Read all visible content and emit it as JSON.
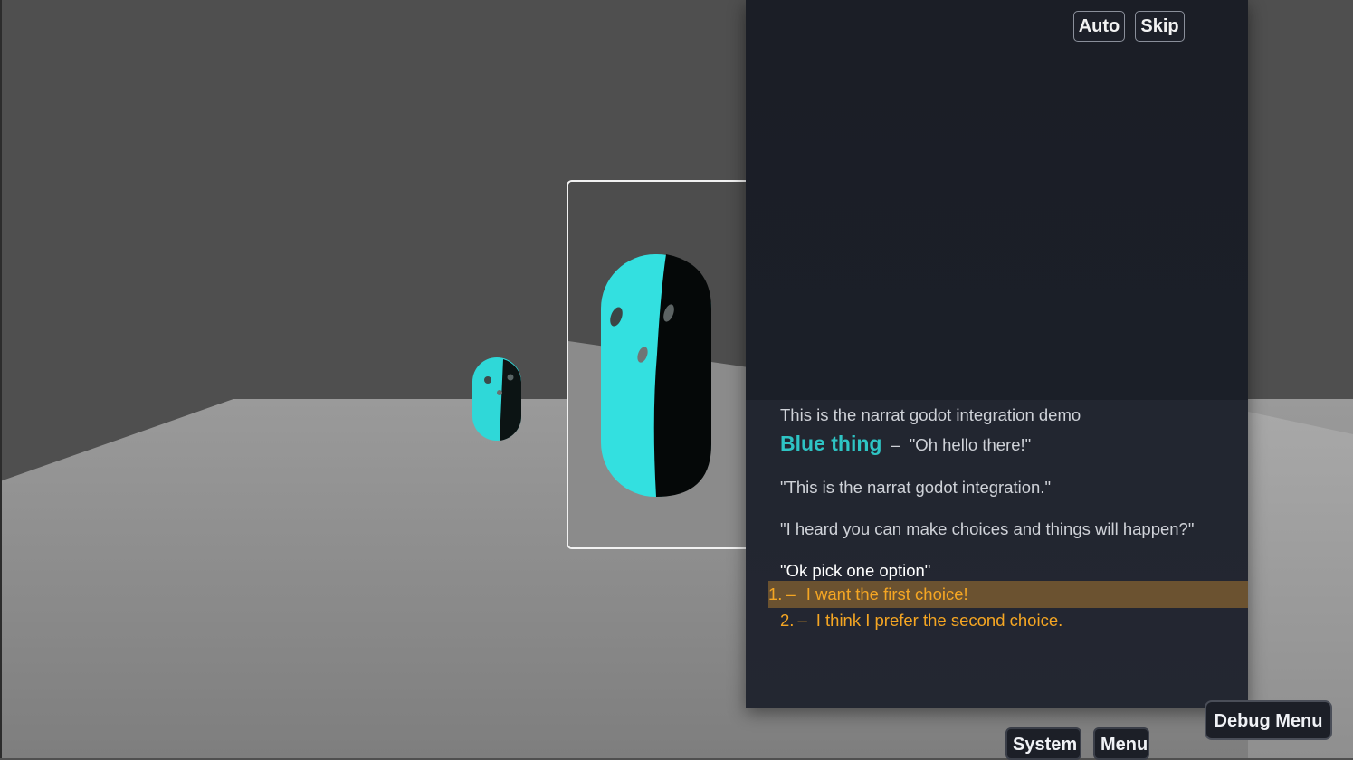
{
  "toolbar": {
    "auto_label": "Auto",
    "skip_label": "Skip"
  },
  "dialogue": {
    "intro": "This is the narrat godot integration demo",
    "speaker": {
      "name": "Blue thing",
      "color": "#2ec4c4",
      "dash": "–",
      "line": "\"Oh hello there!\""
    },
    "lines": [
      "\"This is the narrat godot integration.\"",
      "\"I heard you can make choices and things will happen?\"",
      "\"Ok pick one option\""
    ],
    "choices": [
      {
        "num": "1.",
        "dash": "–",
        "text": "I want the first choice!",
        "selected": true
      },
      {
        "num": "2.",
        "dash": "–",
        "text": "I think I prefer the second choice.",
        "selected": false
      }
    ]
  },
  "bottom": {
    "system_label": "System",
    "menu_label": "Menu",
    "debug_label": "Debug Menu"
  },
  "colors": {
    "accent": "#2ec4c4",
    "choice": "#f5a623",
    "selected_bg": "#6b5230",
    "panel": "#1b1e26"
  }
}
